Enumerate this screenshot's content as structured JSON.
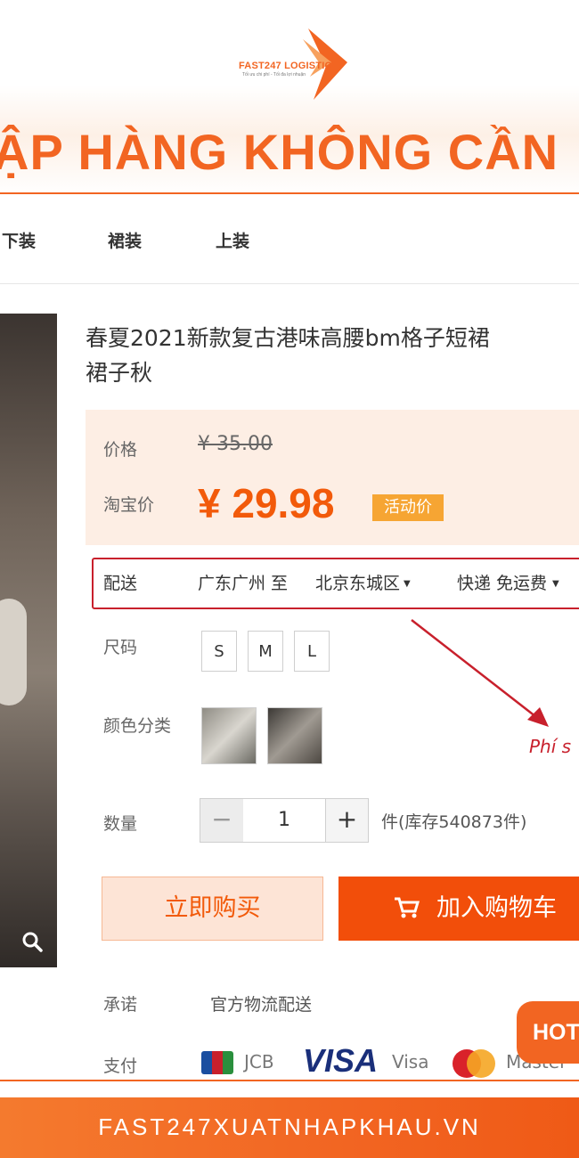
{
  "brand": {
    "name": "FAST247 LOGISTIC",
    "tagline": "Tối ưu chi phí - Tối đa lợi nhuận",
    "headline": "ẬP HÀNG KHÔNG CẦN"
  },
  "category_nav": [
    "下装",
    "裙装",
    "上装"
  ],
  "product": {
    "title_line1": "春夏2021新款复古港味高腰bm格子短裙",
    "title_line2": "裙子秋"
  },
  "price": {
    "label_price": "价格",
    "original": "¥ 35.00",
    "label_taobao": "淘宝价",
    "current": "¥ 29.98",
    "promo_badge": "活动价"
  },
  "shipping": {
    "label": "配送",
    "origin": "广东广州 至",
    "destination": "北京东城区",
    "method": "快递 免运费"
  },
  "size": {
    "label": "尺码",
    "options": [
      "S",
      "M",
      "L"
    ]
  },
  "color": {
    "label": "颜色分类"
  },
  "annotation": "Phí s",
  "quantity": {
    "label": "数量",
    "value": "1",
    "minus": "−",
    "plus": "+",
    "stock": "件(库存540873件)"
  },
  "actions": {
    "buy_now": "立即购买",
    "add_to_cart": "加入购物车"
  },
  "promise": {
    "label": "承诺",
    "value": "官方物流配送"
  },
  "payment": {
    "label": "支付",
    "jcb": "JCB",
    "visa_logo": "VISA",
    "visa": "Visa",
    "master": "Master"
  },
  "hotline_badge": "HOT",
  "footer": {
    "website": "FAST247XUATNHAPKHAU.VN"
  },
  "colors": {
    "brand_orange": "#f26522",
    "price_orange": "#f25a0a",
    "highlight_red": "#c8202c"
  }
}
